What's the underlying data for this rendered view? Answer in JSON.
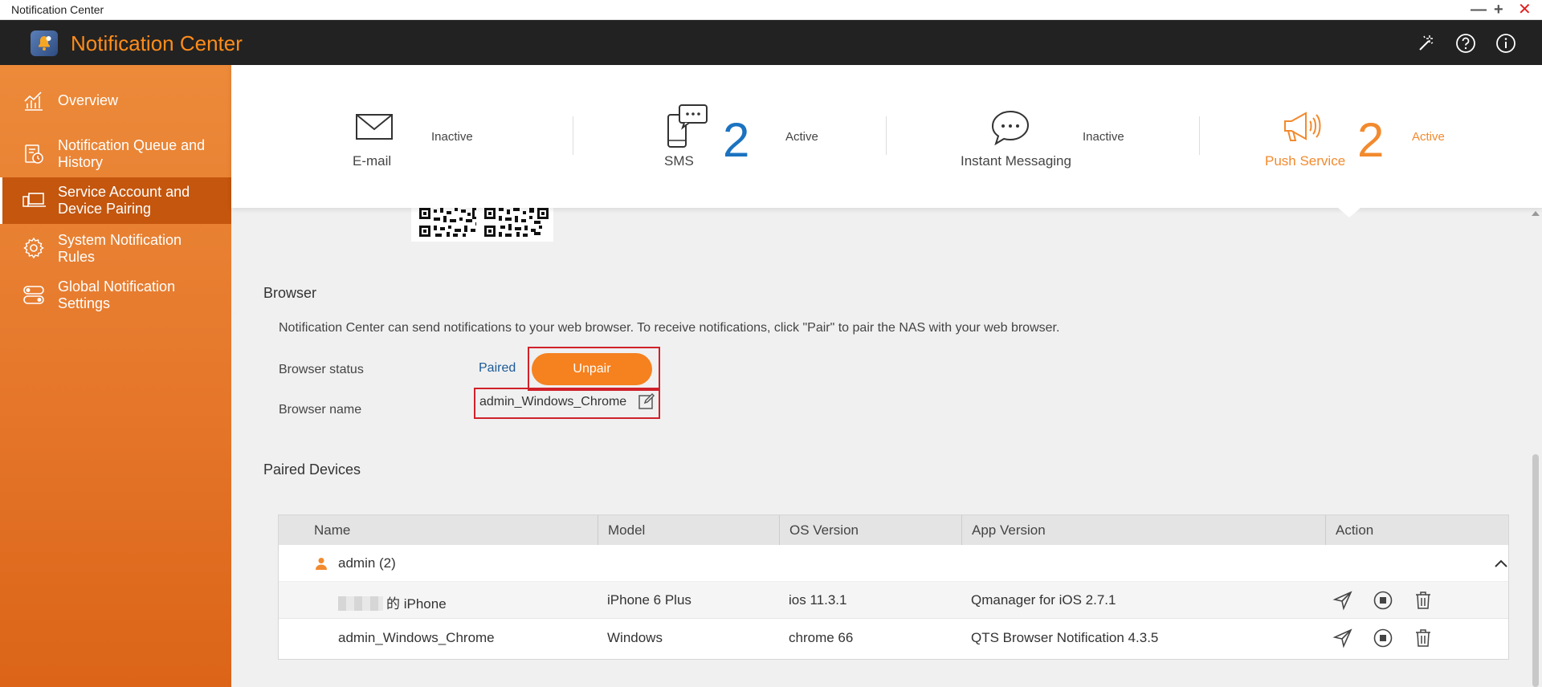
{
  "window": {
    "title": "Notification Center",
    "controls": [
      "minimize",
      "maximize",
      "close"
    ]
  },
  "header": {
    "app_title": "Notification Center",
    "icons": [
      "magic-wand-icon",
      "help-icon",
      "info-icon"
    ]
  },
  "sidebar": {
    "items": [
      {
        "label": "Overview",
        "icon": "chart-icon",
        "active": false
      },
      {
        "label": "Notification Queue and History",
        "icon": "history-icon",
        "active": false
      },
      {
        "label": "Service Account and Device Pairing",
        "icon": "devices-icon",
        "active": true
      },
      {
        "label": "System Notification Rules",
        "icon": "gear-icon",
        "active": false
      },
      {
        "label": "Global Notification Settings",
        "icon": "toggle-icon",
        "active": false
      }
    ]
  },
  "tabs": [
    {
      "label": "E-mail",
      "count": "",
      "status": "Inactive",
      "icon": "envelope-icon"
    },
    {
      "label": "SMS",
      "count": "2",
      "status": "Active",
      "icon": "sms-phone-icon"
    },
    {
      "label": "Instant Messaging",
      "count": "",
      "status": "Inactive",
      "icon": "chat-bubble-icon"
    },
    {
      "label": "Push Service",
      "count": "2",
      "status": "Active",
      "icon": "megaphone-icon",
      "active": true
    }
  ],
  "browser": {
    "section_title": "Browser",
    "description": "Notification Center can send notifications to your web browser. To receive notifications, click \"Pair\" to pair the NAS with your web browser.",
    "status_label": "Browser status",
    "status_value": "Paired",
    "unpair_label": "Unpair",
    "name_label": "Browser name",
    "name_value": "admin_Windows_Chrome"
  },
  "paired_devices": {
    "section_title": "Paired Devices",
    "columns": [
      "Name",
      "Model",
      "OS Version",
      "App Version",
      "Action"
    ],
    "group": {
      "label": "admin (2)"
    },
    "rows": [
      {
        "name": "的 iPhone",
        "model": "iPhone 6 Plus",
        "os": "ios 11.3.1",
        "app": "Qmanager for iOS 2.7.1"
      },
      {
        "name": "admin_Windows_Chrome",
        "model": "Windows",
        "os": "chrome 66",
        "app": "QTS Browser Notification 4.3.5"
      }
    ]
  },
  "colors": {
    "accent": "#f5811f",
    "header_bg": "#222222",
    "count_blue": "#1b73c0",
    "highlight_red": "#d0212a"
  }
}
